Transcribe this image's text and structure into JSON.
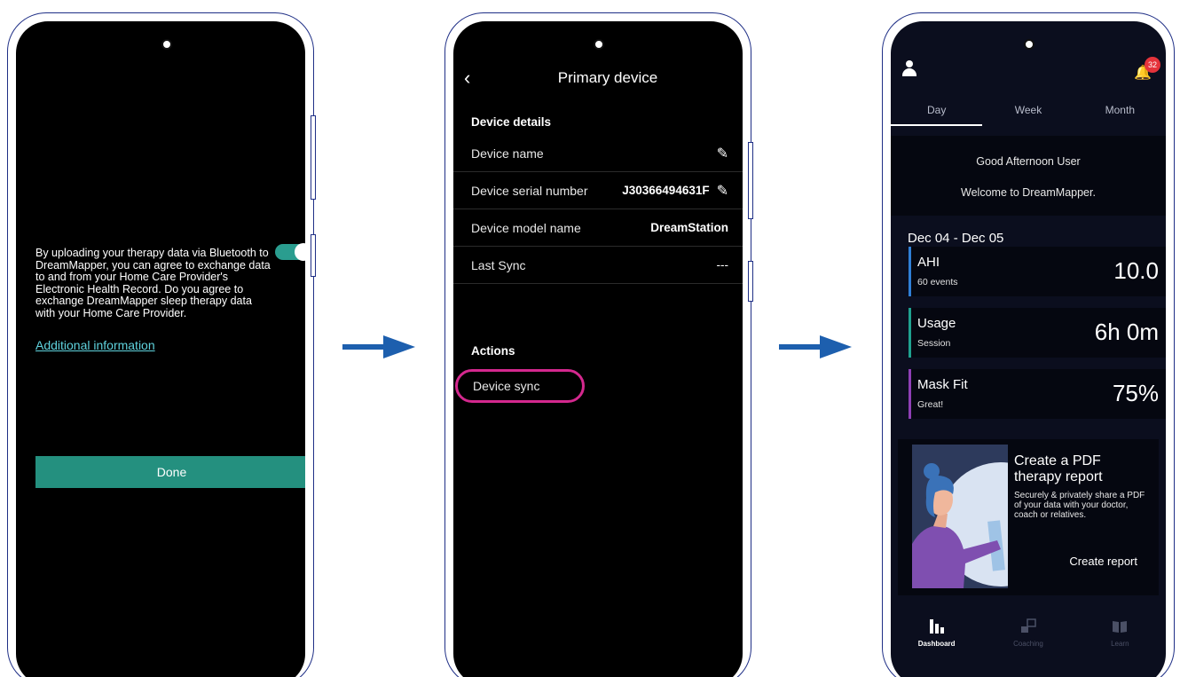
{
  "consent_screen": {
    "text": "By uploading your therapy data via Bluetooth to DreamMapper, you can agree to exchange data to and from your Home Care Provider's Electronic Health Record.  Do you agree to exchange DreamMapper sleep therapy data with your Home Care Provider.",
    "toggle_state": "on",
    "additional_info_link": "Additional information",
    "done_button": "Done"
  },
  "device_screen": {
    "title": "Primary device",
    "details_header": "Device details",
    "rows": [
      {
        "label": "Device name",
        "value": "",
        "editable": true
      },
      {
        "label": "Device serial number",
        "value": "J30366494631F",
        "editable": true
      },
      {
        "label": "Device model name",
        "value": "DreamStation",
        "editable": false
      },
      {
        "label": "Last Sync",
        "value": "---",
        "editable": false
      }
    ],
    "actions_header": "Actions",
    "sync_button": "Device sync"
  },
  "dashboard_screen": {
    "notification_count": "32",
    "tabs": [
      "Day",
      "Week",
      "Month"
    ],
    "active_tab": "Day",
    "greeting": "Good Afternoon User",
    "welcome": "Welcome to DreamMapper.",
    "date_range": "Dec 04 - Dec 05",
    "metrics": [
      {
        "name": "AHI",
        "sub": "60 events",
        "value": "10.0",
        "color": "#2f7fd6"
      },
      {
        "name": "Usage",
        "sub": "Session",
        "value": "6h 0m",
        "color": "#1fa18f"
      },
      {
        "name": "Mask Fit",
        "sub": "Great!",
        "value": "75%",
        "color": "#8e3fb5"
      }
    ],
    "pdf_card": {
      "title": "Create a PDF therapy report",
      "description": "Securely & privately share a PDF of your data with your doctor, coach or relatives.",
      "link": "Create report"
    },
    "nav": [
      {
        "label": "Dashboard",
        "icon": "bar-chart-icon",
        "active": true
      },
      {
        "label": "Coaching",
        "icon": "chat-icon",
        "active": false
      },
      {
        "label": "Learn",
        "icon": "book-icon",
        "active": false
      }
    ]
  },
  "colors": {
    "teal": "#24907f",
    "highlight": "#d4288e",
    "arrow": "#1d5fae",
    "dashboard_bg": "#0b0e1e"
  }
}
